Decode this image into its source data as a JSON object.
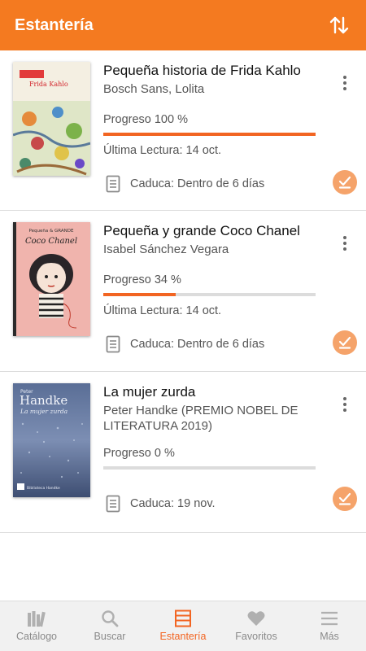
{
  "header": {
    "title": "Estantería",
    "sort_icon": "sort-arrows-icon"
  },
  "colors": {
    "accent": "#f47a20",
    "progress": "#f26522",
    "done_button": "#f5a36a"
  },
  "books": [
    {
      "title": "Pequeña historia de Frida Kahlo",
      "author": "Bosch Sans, Lolita",
      "progress_label": "Progreso 100 %",
      "progress": 1.0,
      "last_read": "Última Lectura: 14 oct.",
      "expiry": "Caduca: Dentro de 6 días",
      "cover_text": "Frida Kahlo"
    },
    {
      "title": "Pequeña y grande Coco Chanel",
      "author": "Isabel Sánchez Vegara",
      "progress_label": "Progreso 34 %",
      "progress": 0.34,
      "last_read": "Última Lectura: 14 oct.",
      "expiry": "Caduca: Dentro de 6 días",
      "cover_text": "Coco Chanel",
      "cover_series": "Pequeña & GRANDE"
    },
    {
      "title": "La mujer zurda",
      "author": "Peter Handke (PREMIO NOBEL DE LITERATURA 2019)",
      "progress_label": "Progreso 0 %",
      "progress": 0.0,
      "expiry": "Caduca: 19 nov.",
      "cover_text": "Handke",
      "cover_subtitle": "La mujer zurda",
      "cover_author_small": "Peter",
      "cover_publisher": "Biblioteca Handke"
    }
  ],
  "nav": [
    {
      "label": "Catálogo",
      "icon": "catalog-icon",
      "active": false
    },
    {
      "label": "Buscar",
      "icon": "search-icon",
      "active": false
    },
    {
      "label": "Estantería",
      "icon": "shelf-icon",
      "active": true
    },
    {
      "label": "Favoritos",
      "icon": "heart-icon",
      "active": false
    },
    {
      "label": "Más",
      "icon": "menu-icon",
      "active": false
    }
  ]
}
